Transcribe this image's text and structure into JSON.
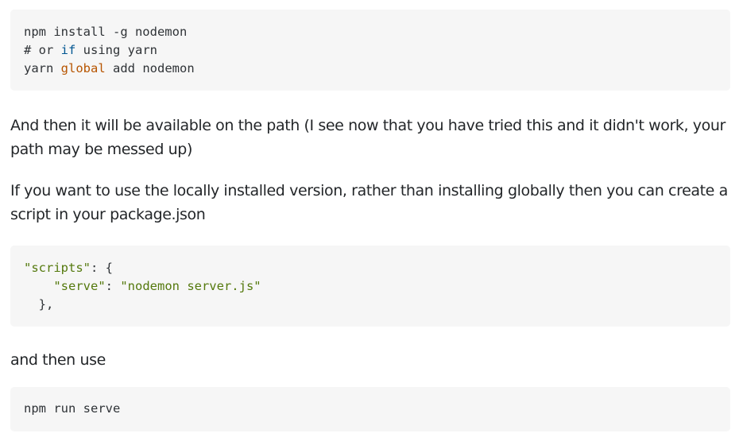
{
  "code_blocks": [
    {
      "lines": [
        {
          "parts": [
            "npm install -g nodemon"
          ]
        },
        {
          "parts": [
            "# or ",
            "if",
            " using yarn"
          ]
        },
        {
          "parts": [
            "yarn ",
            "global",
            " add nodemon"
          ]
        }
      ]
    },
    {
      "lines": [
        {
          "parts": [
            "\"scripts\"",
            ": {"
          ]
        },
        {
          "parts": [
            "    ",
            "\"serve\"",
            ": ",
            "\"nodemon server.js\""
          ]
        },
        {
          "parts": [
            "  },"
          ]
        }
      ]
    },
    {
      "lines": [
        {
          "parts": [
            "npm run serve"
          ]
        }
      ]
    }
  ],
  "paragraphs": [
    "And then it will be available on the path (I see now that you have tried this and it didn't work, your path may be messed up)",
    "If you want to use the locally installed version, rather than installing globally then you can create a script in your package.json",
    "and then use"
  ],
  "colors": {
    "keyword": "#015692",
    "builtin": "#b75501",
    "string": "#54790d",
    "code_bg": "#f6f6f6",
    "text": "#232629"
  }
}
